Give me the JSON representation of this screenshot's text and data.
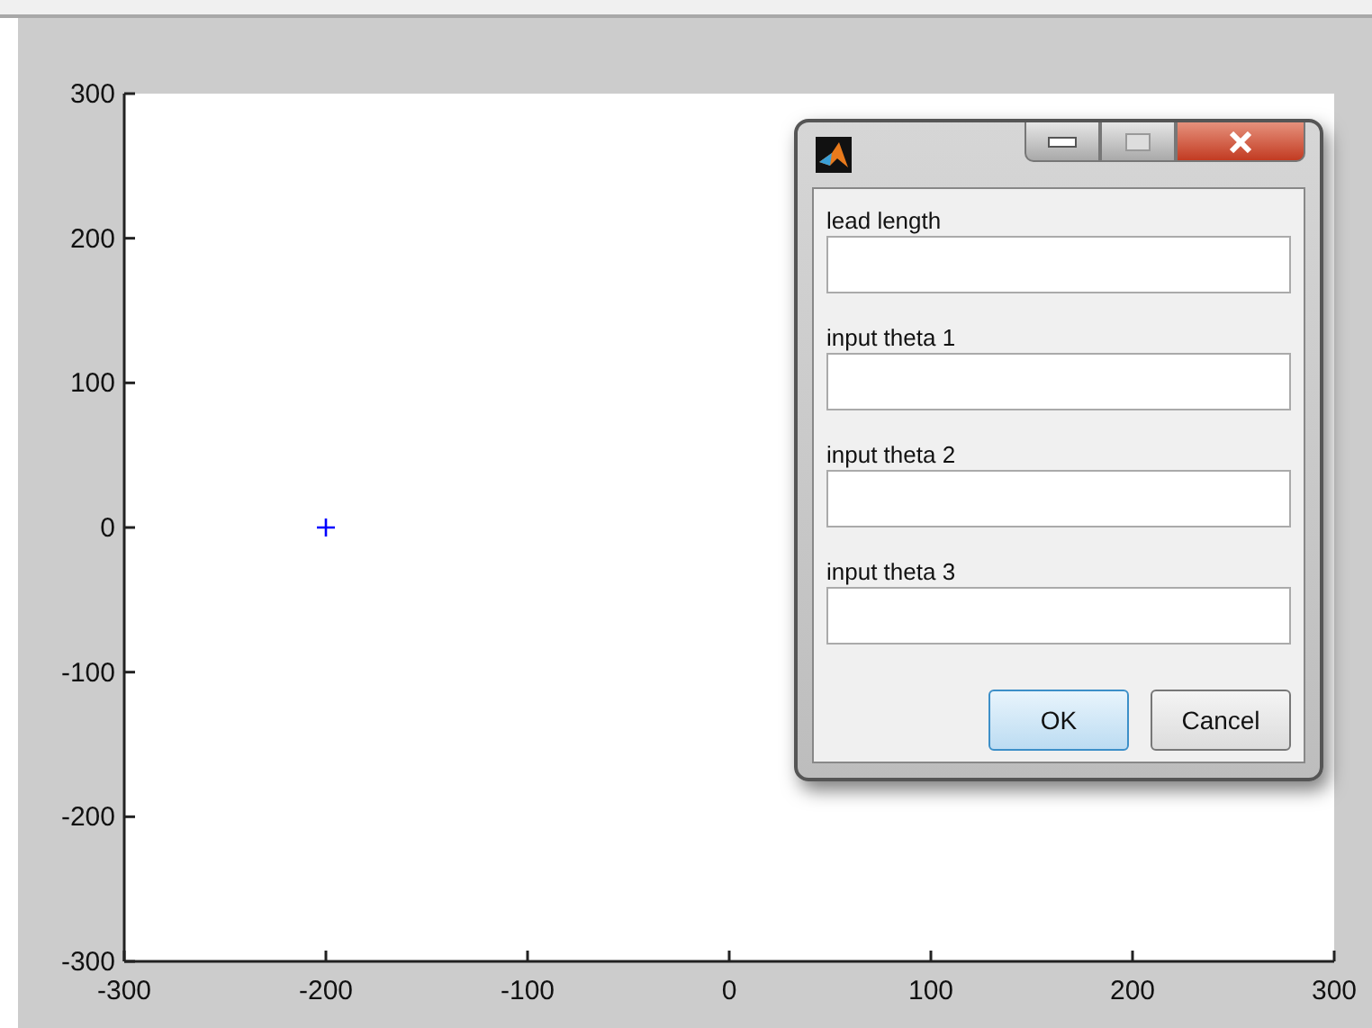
{
  "figure": {
    "chart_data": {
      "type": "scatter",
      "x": [
        -200
      ],
      "series": [
        {
          "color": "#0000ff",
          "values": [
            0
          ]
        }
      ],
      "xlim": [
        -300,
        300
      ],
      "ylim": [
        -300,
        300
      ],
      "xticks": [
        -300,
        -200,
        -100,
        0,
        100,
        200,
        300
      ],
      "yticks": [
        -300,
        -200,
        -100,
        0,
        100,
        200,
        300
      ]
    }
  },
  "dialog": {
    "fields": [
      {
        "label": "lead length"
      },
      {
        "label": "input theta 1"
      },
      {
        "label": "input theta 2"
      },
      {
        "label": "input theta 3"
      }
    ],
    "buttons": [
      {
        "label": "OK",
        "default": true
      },
      {
        "label": "Cancel",
        "default": false
      }
    ]
  }
}
